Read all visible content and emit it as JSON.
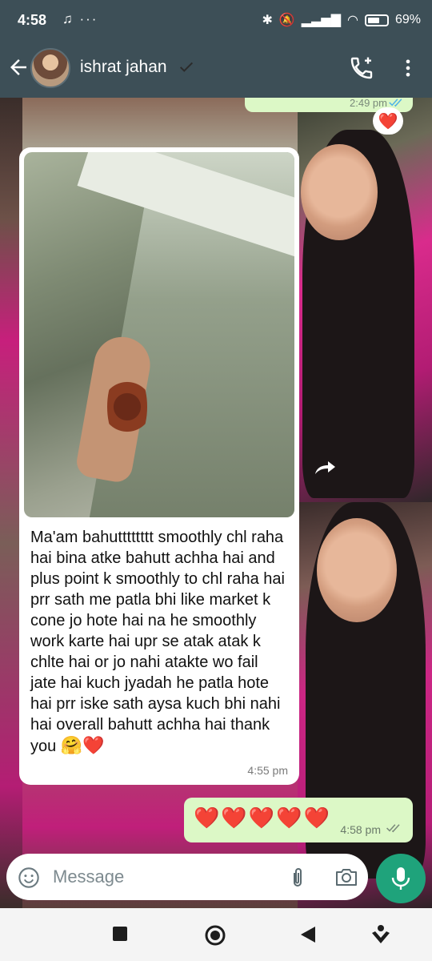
{
  "status_bar": {
    "time": "4:58",
    "notif_icons": "♫ ···",
    "battery_pct": "69%",
    "battery_level": 0.69
  },
  "header": {
    "contact_name": "ishrat jahan"
  },
  "messages": {
    "prev_out_time": "2:49 pm",
    "reaction": "❤️",
    "incoming": {
      "text": "Ma'am bahutttttttt smoothly chl raha hai bina atke bahutt achha hai and plus point k smoothly to chl raha hai prr sath me patla bhi like market k cone jo hote hai na he smoothly work karte hai upr se atak atak k chlte hai or jo nahi atakte wo fail jate hai kuch jyadah he patla hote hai prr iske sath aysa kuch bhi nahi hai overall bahutt achha hai thank you",
      "emojis": "🤗❤️",
      "time": "4:55 pm"
    },
    "outgoing": {
      "hearts": "❤️❤️❤️❤️❤️",
      "time": "4:58 pm"
    }
  },
  "composer": {
    "placeholder": "Message"
  },
  "colors": {
    "header": "#3d4f57",
    "accent": "#1fa37b",
    "out_bubble": "#dcf8c6"
  }
}
